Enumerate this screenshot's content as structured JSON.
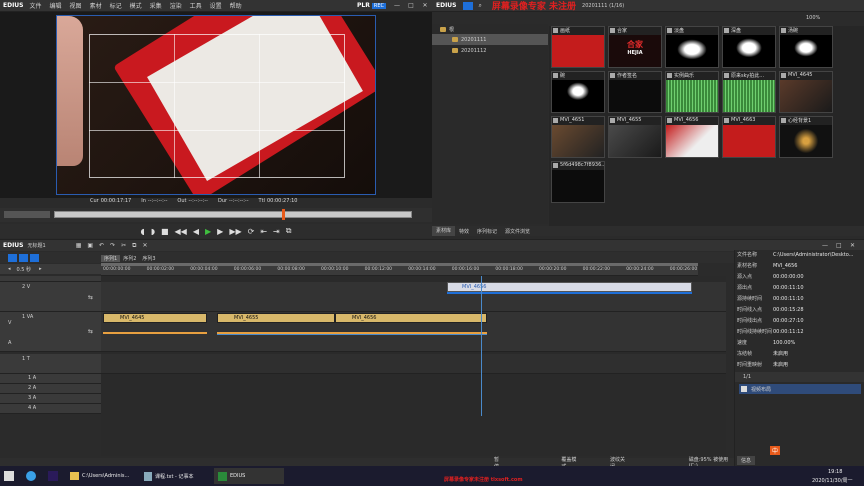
{
  "app": {
    "name": "EDIUS",
    "menus": [
      "文件",
      "编辑",
      "视图",
      "素材",
      "标记",
      "模式",
      "采集",
      "渲染",
      "工具",
      "设置",
      "帮助"
    ],
    "plr": "PLR",
    "rec": "REC"
  },
  "watermark": "屏幕录像专家 未注册",
  "player": {
    "cur_label": "Cur",
    "cur": "00:00:17:17",
    "in_label": "In",
    "in": "--:--:--:--",
    "out_label": "Out",
    "out": "--:--:--:--",
    "dur_label": "Dur",
    "dur": "--:--:--:--",
    "ttl_label": "Ttl",
    "ttl": "00:00:27:10"
  },
  "bin": {
    "path": "20201111 (1/16)",
    "zoom": "100%",
    "folders": [
      "根",
      "20201111",
      "20201112"
    ],
    "clips": [
      "画纸",
      "合家",
      "淡盘",
      "深盘",
      "汤碗",
      "碗",
      "作者签名",
      "实例曲乐",
      "原来sky拍此...",
      "MVI_4645",
      "MVI_4651",
      "MVI_4655",
      "MVI_4656",
      "MVI_4663",
      "心经背景1",
      "5f6d498c7f8936..."
    ],
    "tabs": [
      "素材库",
      "特效",
      "序列标记",
      "源文件浏览"
    ],
    "hejia_text": "合家",
    "hejia_sub": "HEJIA"
  },
  "timeline": {
    "title": "无标题1",
    "zoom": "0.5 秒",
    "seq_tabs": [
      "序列1",
      "序列2",
      "序列3"
    ],
    "ruler": [
      "00:00:00:00",
      "00:00:02:00",
      "00:00:04:00",
      "00:00:06:00",
      "00:00:08:00",
      "00:00:10:00",
      "00:00:12:00",
      "00:00:14:00",
      "00:00:16:00",
      "00:00:18:00",
      "00:00:20:00",
      "00:00:22:00",
      "00:00:24:00",
      "00:00:26:00"
    ],
    "tracks": {
      "t2v": "2 V",
      "t1va": "1 VA",
      "t1t": "1 T",
      "a1": "1 A",
      "a2": "2 A",
      "a3": "3 A",
      "a4": "4 A",
      "v": "V",
      "a": "A"
    },
    "clips": {
      "c2v": "MVI_4656",
      "c1": "MVI_4645",
      "c2": "MVI_4655",
      "c3": "MVI_4656"
    }
  },
  "info": {
    "rows": [
      [
        "文件名称",
        "C:\\Users\\Administrator\\Deskto..."
      ],
      [
        "素材名称",
        "MVI_4656"
      ],
      [
        "源入点",
        "00:00:00:00"
      ],
      [
        "源出点",
        "00:00:11:10"
      ],
      [
        "源持续时间",
        "00:00:11:10"
      ],
      [
        "时间线入点",
        "00:00:15:28"
      ],
      [
        "时间线出点",
        "00:00:27:10"
      ],
      [
        "时间线持续时间",
        "00:00:11:12"
      ],
      [
        "速度",
        "100.00%"
      ],
      [
        "冻结帧",
        "未启用"
      ],
      [
        "时间重映射",
        "未启用"
      ]
    ],
    "page": "1/1",
    "effect": "视频布局",
    "footer_tab": "信息"
  },
  "status": {
    "pause": "暂停",
    "overwrite": "覆盖模式",
    "ripple": "波纹关闭",
    "disk": "磁盘:95% 被使用(C:)"
  },
  "taskbar": {
    "explorer": "C:\\Users\\Adminis...",
    "notepad": "课程.txt - 记事本",
    "edius": "EDIUS",
    "time": "19:18",
    "date": "2020/11/30/周一",
    "watermark2": "屏幕录像专家未注册 tlxsoft.com",
    "ime": "中"
  },
  "colors": {
    "accent": "#1e6fd9",
    "clip": "#d8b86a",
    "red": "#d8232a"
  }
}
